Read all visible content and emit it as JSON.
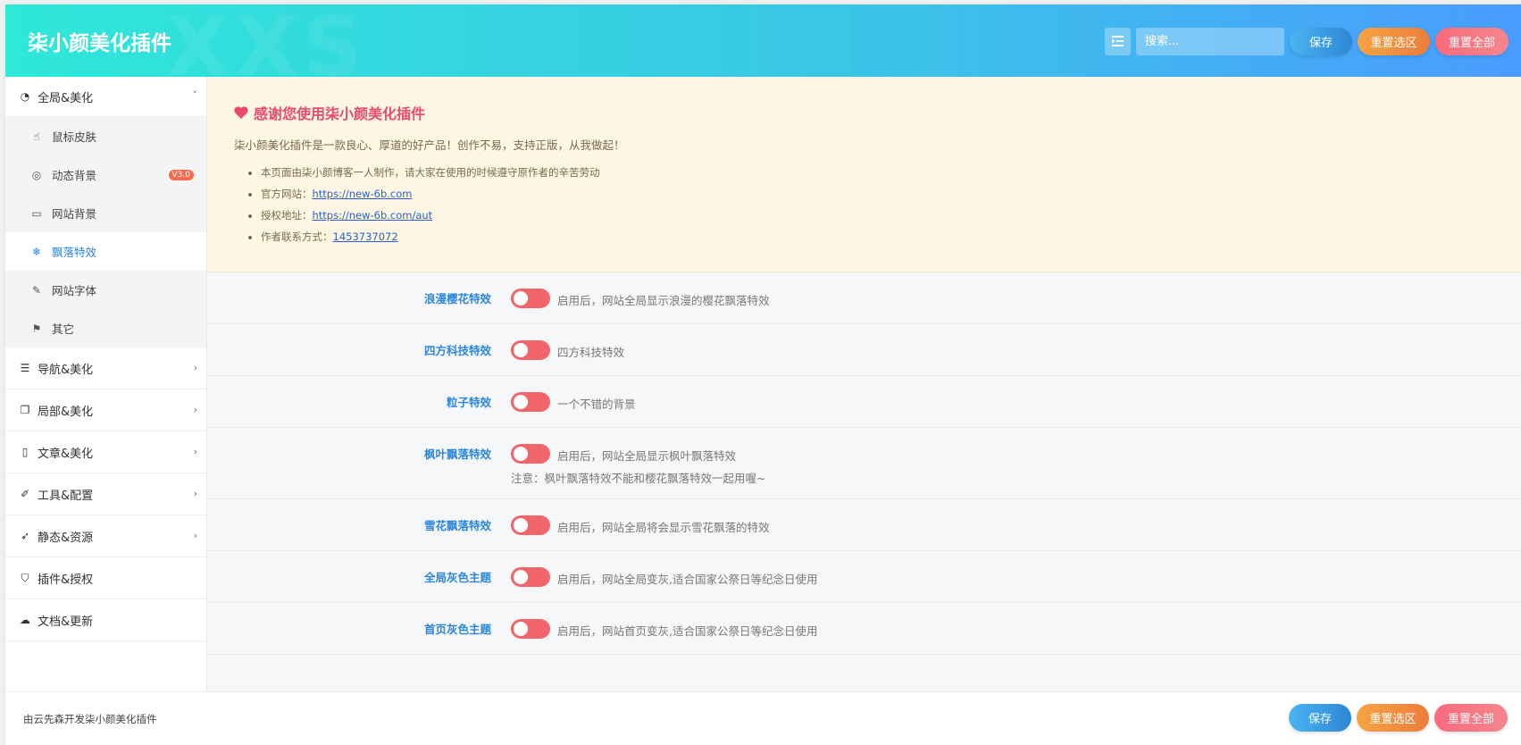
{
  "header": {
    "brand": "柒小颜美化插件",
    "watermark": "XXS",
    "search_placeholder": "搜索...",
    "save_label": "保存",
    "reset_section_label": "重置选区",
    "reset_all_label": "重置全部"
  },
  "sidebar": {
    "groups": [
      {
        "label": "全局&美化",
        "icon": "dashboard-icon",
        "expanded": true
      },
      {
        "label": "导航&美化",
        "icon": "list-icon"
      },
      {
        "label": "局部&美化",
        "icon": "copy-icon"
      },
      {
        "label": "文章&美化",
        "icon": "map-icon"
      },
      {
        "label": "工具&配置",
        "icon": "wrench-icon"
      },
      {
        "label": "静态&资源",
        "icon": "rocket-icon"
      },
      {
        "label": "插件&授权",
        "icon": "gitlab-icon"
      },
      {
        "label": "文档&更新",
        "icon": "cloud-download-icon"
      }
    ],
    "sub_items": [
      {
        "label": "鼠标皮肤",
        "icon": "hand-pointer-icon"
      },
      {
        "label": "动态背景",
        "icon": "life-ring-icon",
        "badge": "V3.0"
      },
      {
        "label": "网站背景",
        "icon": "desktop-icon"
      },
      {
        "label": "飘落特效",
        "icon": "snowflake-icon",
        "active": true
      },
      {
        "label": "网站字体",
        "icon": "pencil-icon"
      },
      {
        "label": "其它",
        "icon": "flag-icon"
      }
    ]
  },
  "notice": {
    "title": "感谢您使用柒小颜美化插件",
    "intro": "柒小颜美化插件是一款良心、厚道的好产品！创作不易，支持正版，从我做起！",
    "line1": "本页面由柒小颜博客一人制作，请大家在使用的时候遵守原作者的辛苦劳动",
    "site_label": "官方网站：",
    "site_link": "https://new-6b.com",
    "auth_label": "授权地址：",
    "auth_link": "https://new-6b.com/aut",
    "contact_label": "作者联系方式：",
    "contact_link": "1453737072"
  },
  "options": [
    {
      "label": "浪漫樱花特效",
      "desc": "启用后，网站全局显示浪漫的樱花飘落特效",
      "enabled": false
    },
    {
      "label": "四方科技特效",
      "desc": "四方科技特效",
      "enabled": false
    },
    {
      "label": "粒子特效",
      "desc": "一个不错的背景",
      "enabled": false
    },
    {
      "label": "枫叶飘落特效",
      "desc": "启用后，网站全局显示枫叶飘落特效",
      "note": "注意：枫叶飘落特效不能和樱花飘落特效一起用喔~",
      "enabled": false
    },
    {
      "label": "雪花飘落特效",
      "desc": "启用后，网站全局将会显示雪花飘落的特效",
      "enabled": false
    },
    {
      "label": "全局灰色主题",
      "desc": "启用后，网站全局变灰,适合国家公祭日等纪念日使用",
      "enabled": false
    },
    {
      "label": "首页灰色主题",
      "desc": "启用后，网站首页变灰,适合国家公祭日等纪念日使用",
      "enabled": false
    }
  ],
  "footer": {
    "credit": "由云先森开发柒小颜美化插件",
    "save_label": "保存",
    "reset_section_label": "重置选区",
    "reset_all_label": "重置全部"
  },
  "colors": {
    "accent": "#2b86dc",
    "toggle_off": "#f2666b",
    "notice_bg": "#fdf6e3",
    "notice_title": "#ea4a6e"
  }
}
